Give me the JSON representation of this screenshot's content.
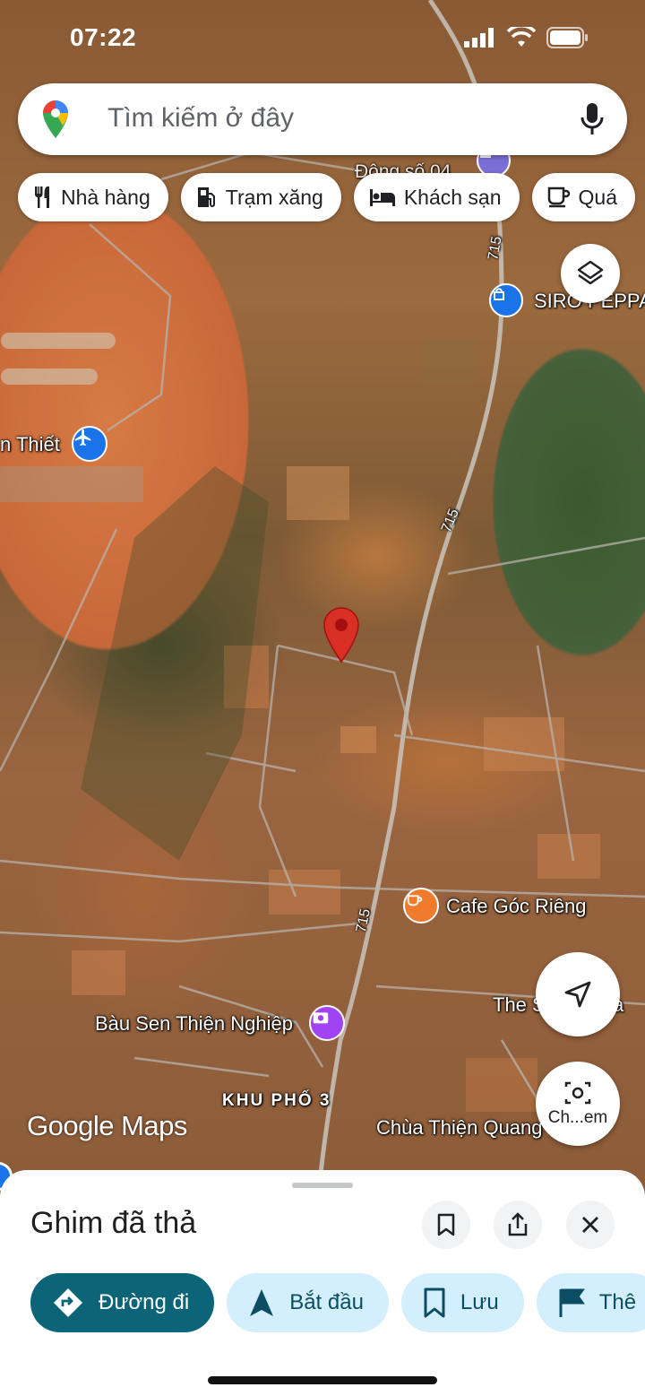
{
  "status_bar": {
    "time": "07:22"
  },
  "search": {
    "placeholder": "Tìm kiếm ở đây"
  },
  "chips": [
    {
      "label": "Nhà hàng",
      "icon": "restaurant-icon"
    },
    {
      "label": "Trạm xăng",
      "icon": "gas-station-icon"
    },
    {
      "label": "Khách sạn",
      "icon": "hotel-icon"
    },
    {
      "label": "Quá",
      "icon": "coffee-icon"
    }
  ],
  "map_labels": {
    "top_partial": "Động số 04",
    "road_715_a": "715",
    "road_715_b": "715",
    "road_715_c": "715",
    "siro": "SIRO PEPPA",
    "airport": "n Thiết",
    "cafe": "Cafe Góc Riêng",
    "the_s": "The S",
    "the_s_end": "a",
    "bau_sen": "Bàu Sen Thiện Nghiệp",
    "khu_pho": "KHU PHỐ 3",
    "chua": "Chùa Thiện Quang",
    "screenshot_btn": "Ch...em"
  },
  "branding": {
    "google_maps": "Google Maps"
  },
  "sheet": {
    "title": "Ghim đã thả",
    "actions": [
      {
        "label": "Đường đi",
        "icon": "directions-icon"
      },
      {
        "label": "Bắt đầu",
        "icon": "navigation-arrow-icon"
      },
      {
        "label": "Lưu",
        "icon": "bookmark-icon"
      },
      {
        "label": "Thê",
        "icon": "flag-icon"
      }
    ]
  },
  "colors": {
    "pin": "#d93025",
    "primary_action": "#0b6478",
    "secondary_action": "#d3eefc",
    "cafe_poi": "#f07b2c",
    "airport_poi": "#1a73e8",
    "photo_poi": "#a142f4"
  }
}
